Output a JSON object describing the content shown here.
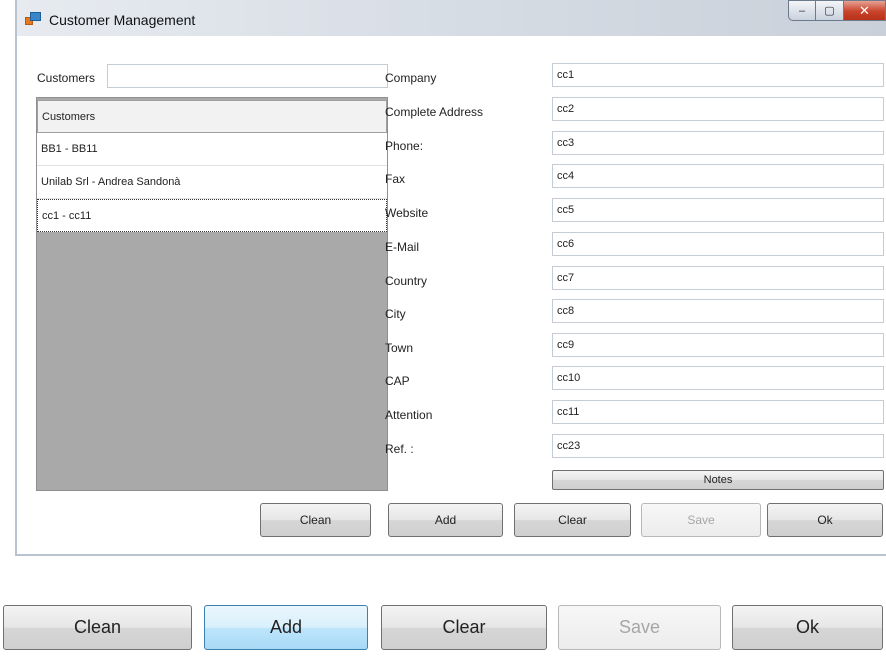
{
  "window": {
    "title": "Customer Management",
    "controls": {
      "minimize": "–",
      "maximize": "▢",
      "close": "✕"
    }
  },
  "search": {
    "label": "Customers",
    "value": ""
  },
  "customer_list": {
    "header": "Customers",
    "rows": [
      "BB1 - BB11",
      "Unilab Srl - Andrea Sandonà",
      "cc1 - cc11"
    ],
    "selected_index": 2
  },
  "form": {
    "fields": [
      {
        "label": "Company",
        "value": "cc1"
      },
      {
        "label": "Complete Address",
        "value": "cc2"
      },
      {
        "label": "Phone:",
        "value": "cc3"
      },
      {
        "label": "Fax",
        "value": "cc4"
      },
      {
        "label": "Website",
        "value": "cc5"
      },
      {
        "label": "E-Mail",
        "value": "cc6"
      },
      {
        "label": "Country",
        "value": "cc7"
      },
      {
        "label": "City",
        "value": "cc8"
      },
      {
        "label": "Town",
        "value": "cc9"
      },
      {
        "label": "CAP",
        "value": "cc10"
      },
      {
        "label": "Attention",
        "value": "cc11"
      },
      {
        "label": "Ref. :",
        "value": "cc23"
      }
    ],
    "notes_label": "Notes"
  },
  "buttons": {
    "clean": "Clean",
    "add": "Add",
    "clear": "Clear",
    "save": "Save",
    "ok": "Ok"
  },
  "zoomed_buttons": {
    "clean": "Clean",
    "add": "Add",
    "clear": "Clear",
    "save": "Save",
    "ok": "Ok"
  },
  "colors": {
    "list_background": "#a9a9a9",
    "hover_button": "#bee6fd",
    "close_button": "#c8432c"
  }
}
